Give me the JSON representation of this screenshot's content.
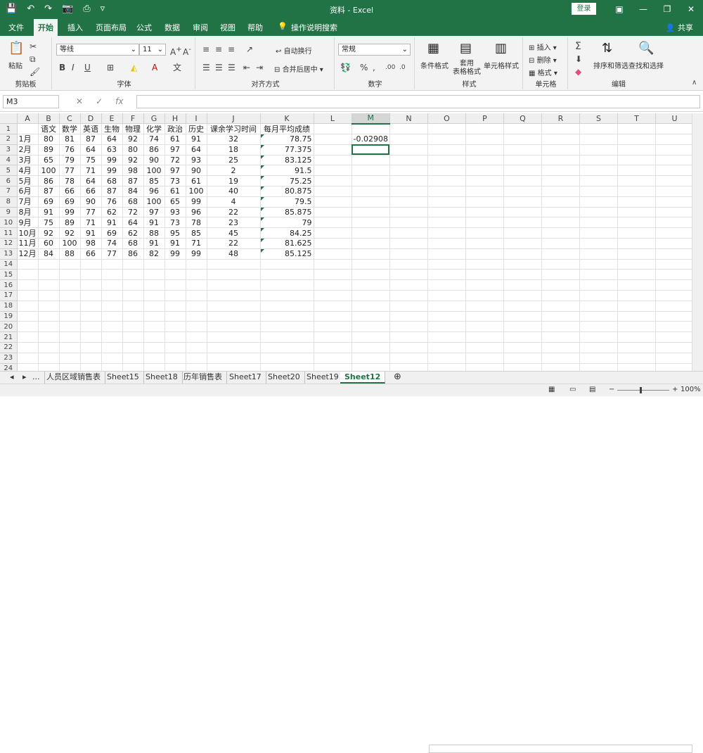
{
  "app": {
    "title": "资料  -  Excel",
    "login_label": "登录",
    "share_label": "共享"
  },
  "qat": {
    "save_icon": "save-icon",
    "undo_icon": "undo-icon",
    "redo_icon": "redo-icon"
  },
  "tabs": [
    {
      "label": "文件",
      "active": false
    },
    {
      "label": "开始",
      "active": true
    },
    {
      "label": "插入",
      "active": false
    },
    {
      "label": "页面布局",
      "active": false
    },
    {
      "label": "公式",
      "active": false
    },
    {
      "label": "数据",
      "active": false
    },
    {
      "label": "审阅",
      "active": false
    },
    {
      "label": "视图",
      "active": false
    },
    {
      "label": "帮助",
      "active": false
    },
    {
      "label": "操作说明搜索",
      "active": false
    }
  ],
  "ribbon": {
    "clipboard": {
      "paste_label": "粘贴",
      "group_label": "剪贴板"
    },
    "font": {
      "font_name": "等线",
      "font_size": "11",
      "group_label": "字体"
    },
    "alignment": {
      "wrap_label": "自动换行",
      "merge_label": "合并后居中",
      "group_label": "对齐方式"
    },
    "number": {
      "format": "常规",
      "group_label": "数字"
    },
    "styles": {
      "cond_label": "条件格式",
      "table_label": "套用\n表格格式",
      "cell_label": "单元格样式",
      "group_label": "样式"
    },
    "cells": {
      "insert_label": "插入",
      "delete_label": "删除",
      "format_label": "格式",
      "group_label": "单元格"
    },
    "editing": {
      "sort_label": "排序和筛选",
      "find_label": "查找和选择",
      "group_label": "编辑"
    }
  },
  "formula_bar": {
    "name_box": "M3",
    "fx": "fx",
    "content": ""
  },
  "columns": [
    "A",
    "B",
    "C",
    "D",
    "E",
    "F",
    "G",
    "H",
    "I",
    "J",
    "K",
    "L",
    "M",
    "N",
    "O",
    "P",
    "Q",
    "R",
    "S",
    "T",
    "U"
  ],
  "header_row": [
    "",
    "语文",
    "数学",
    "英语",
    "生物",
    "物理",
    "化学",
    "政治",
    "历史",
    "课余学习时间",
    "每月平均成绩"
  ],
  "rows": [
    [
      "1月",
      80,
      81,
      87,
      64,
      92,
      74,
      61,
      91,
      32,
      "78.75"
    ],
    [
      "2月",
      89,
      76,
      64,
      63,
      80,
      86,
      97,
      64,
      18,
      "77.375"
    ],
    [
      "3月",
      65,
      79,
      75,
      99,
      92,
      90,
      72,
      93,
      25,
      "83.125"
    ],
    [
      "4月",
      100,
      77,
      71,
      99,
      98,
      100,
      97,
      90,
      2,
      "91.5"
    ],
    [
      "5月",
      86,
      78,
      64,
      68,
      87,
      85,
      73,
      61,
      19,
      "75.25"
    ],
    [
      "6月",
      87,
      66,
      66,
      87,
      84,
      96,
      61,
      100,
      40,
      "80.875"
    ],
    [
      "7月",
      69,
      69,
      90,
      76,
      68,
      100,
      65,
      99,
      4,
      "79.5"
    ],
    [
      "8月",
      91,
      99,
      77,
      62,
      72,
      97,
      93,
      96,
      22,
      "85.875"
    ],
    [
      "9月",
      75,
      89,
      71,
      91,
      64,
      91,
      73,
      78,
      23,
      "79"
    ],
    [
      "10月",
      92,
      92,
      91,
      69,
      62,
      88,
      95,
      85,
      45,
      "84.25"
    ],
    [
      "11月",
      60,
      100,
      98,
      74,
      68,
      91,
      91,
      71,
      22,
      "81.625"
    ],
    [
      "12月",
      84,
      88,
      66,
      77,
      86,
      82,
      99,
      99,
      48,
      "85.125"
    ]
  ],
  "m2_value": "-0.02908",
  "total_rows": 24,
  "sheets": [
    {
      "label": "人员区域销售表",
      "active": false
    },
    {
      "label": "Sheet15",
      "active": false
    },
    {
      "label": "Sheet18",
      "active": false
    },
    {
      "label": "历年销售表",
      "active": false
    },
    {
      "label": "Sheet17",
      "active": false
    },
    {
      "label": "Sheet20",
      "active": false
    },
    {
      "label": "Sheet19",
      "active": false
    },
    {
      "label": "Sheet12",
      "active": true
    }
  ],
  "ellipsis": "...",
  "status": {
    "zoom": "100%"
  }
}
